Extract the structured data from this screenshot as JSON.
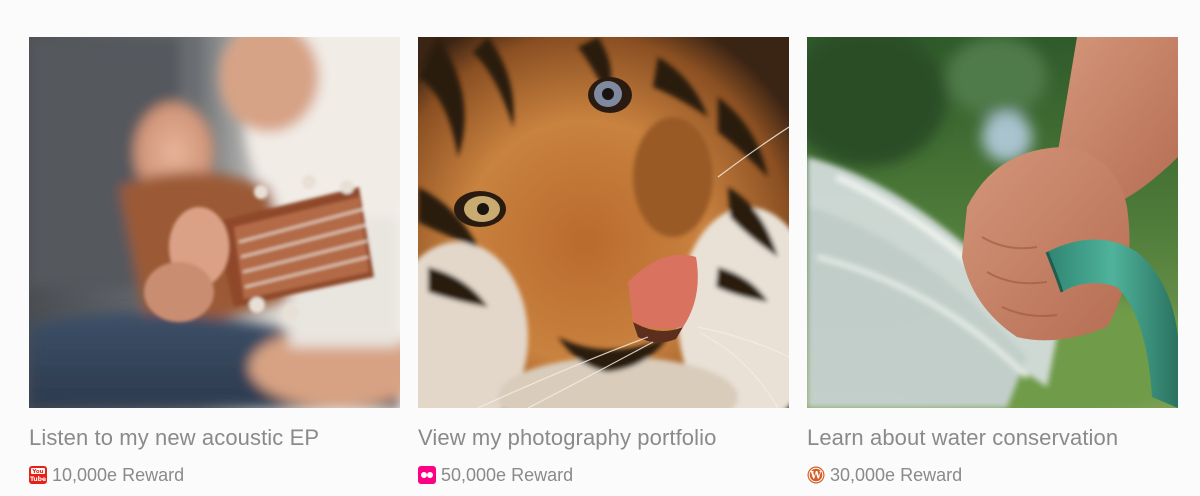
{
  "campaigns": [
    {
      "title": "Listen to my new acoustic EP",
      "reward": "10,000e Reward",
      "platform_icon": "youtube-icon",
      "image_subject": "acoustic-guitar-photo"
    },
    {
      "title": "View my photography portfolio",
      "reward": "50,000e Reward",
      "platform_icon": "flickr-icon",
      "image_subject": "tiger-photo"
    },
    {
      "title": "Learn about water conservation",
      "reward": "30,000e Reward",
      "platform_icon": "wordpress-icon",
      "image_subject": "garden-hose-photo"
    }
  ],
  "colors": {
    "background": "#fbfbfc",
    "text": "#8a8a8a",
    "youtube": "#e62117",
    "flickr": "#ff0084",
    "wordpress": "#d35f2a"
  }
}
